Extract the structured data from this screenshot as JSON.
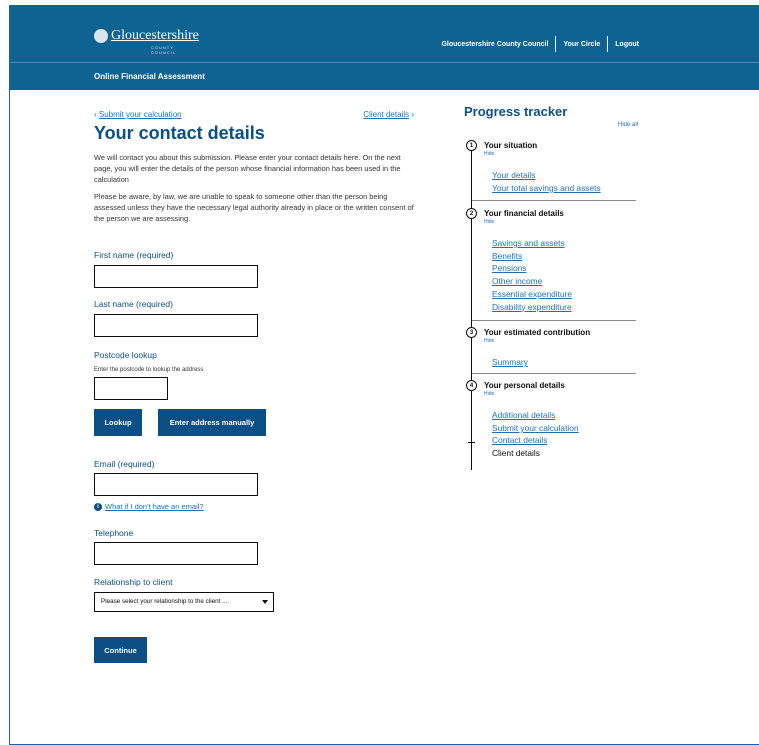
{
  "header": {
    "logo_text": "Gloucestershire",
    "logo_sub": "COUNTY COUNCIL",
    "links": [
      "Gloucestershire County Council",
      "Your Circle",
      "Logout"
    ],
    "subtitle": "Online Financial Assessment"
  },
  "nav": {
    "back_label": "Submit your calculation",
    "forward_label": "Client details"
  },
  "main": {
    "title": "Your contact details",
    "intro": "We will contact you about this submission. Please enter your contact details here. On the next page, you will enter the details of the person whose financial information has been used in the calculation",
    "law_note": "Please be aware, by law, we are unable to speak to someone other than the person being assessed unless they have the necessary legal authority already in place or the written consent of the person we are assessing."
  },
  "form": {
    "first_name_label": "First name (required)",
    "first_name_value": "",
    "last_name_label": "Last name (required)",
    "last_name_value": "",
    "postcode_label": "Postcode lookup",
    "postcode_hint": "Enter the postcode to lookup the address",
    "postcode_value": "",
    "lookup_button": "Lookup",
    "manual_button": "Enter address manually",
    "email_label": "Email (required)",
    "email_value": "",
    "no_email_link": "What if I don't have an email?",
    "telephone_label": "Telephone",
    "telephone_value": "",
    "relationship_label": "Relationship to client",
    "relationship_value": "Please select your relationship to the client ...",
    "continue_button": "Continue"
  },
  "tracker": {
    "title": "Progress tracker",
    "hide_all": "Hide all",
    "steps": [
      {
        "num": "1",
        "title": "Your situation",
        "hide": "Hide",
        "links": [
          "Your details",
          "Your total savings and assets"
        ]
      },
      {
        "num": "2",
        "title": "Your financial details",
        "hide": "Hide",
        "links": [
          "Savings and assets",
          "Benefits",
          "Pensions",
          "Other income",
          "Essential expenditure",
          "Disability expenditure"
        ]
      },
      {
        "num": "3",
        "title": "Your estimated contribution",
        "hide": "Hide",
        "links": [
          "Summary"
        ]
      },
      {
        "num": "4",
        "title": "Your personal details",
        "hide": "Hide",
        "links": [
          "Additional details",
          "Submit your calculation",
          "Contact details"
        ],
        "current": "Client details"
      }
    ]
  },
  "colors": {
    "header_bg": "#0e6392",
    "primary": "#0b4f86",
    "link": "#1d70b8"
  }
}
